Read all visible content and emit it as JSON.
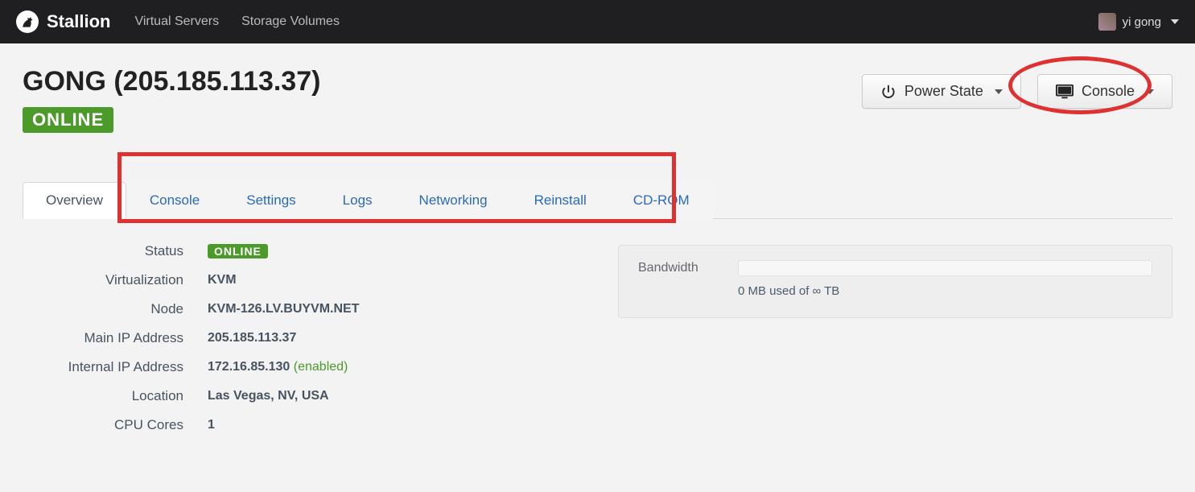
{
  "navbar": {
    "brand": "Stallion",
    "links": {
      "virtual_servers": "Virtual Servers",
      "storage_volumes": "Storage Volumes"
    },
    "user": "yi gong"
  },
  "header": {
    "title": "GONG (205.185.113.37)",
    "status_badge": "ONLINE",
    "buttons": {
      "power_state": "Power State",
      "console": "Console"
    }
  },
  "tabs": {
    "overview": "Overview",
    "console": "Console",
    "settings": "Settings",
    "logs": "Logs",
    "networking": "Networking",
    "reinstall": "Reinstall",
    "cdrom": "CD-ROM"
  },
  "details": {
    "status_label": "Status",
    "status_value": "ONLINE",
    "virtualization_label": "Virtualization",
    "virtualization_value": "KVM",
    "node_label": "Node",
    "node_value": "KVM-126.LV.BUYVM.NET",
    "main_ip_label": "Main IP Address",
    "main_ip_value": "205.185.113.37",
    "internal_ip_label": "Internal IP Address",
    "internal_ip_value": "172.16.85.130",
    "internal_ip_state": "(enabled)",
    "location_label": "Location",
    "location_value": "Las Vegas, NV, USA",
    "cpu_label": "CPU Cores",
    "cpu_value": "1"
  },
  "bandwidth": {
    "label": "Bandwidth",
    "usage_text": "0 MB used of ∞ TB"
  }
}
